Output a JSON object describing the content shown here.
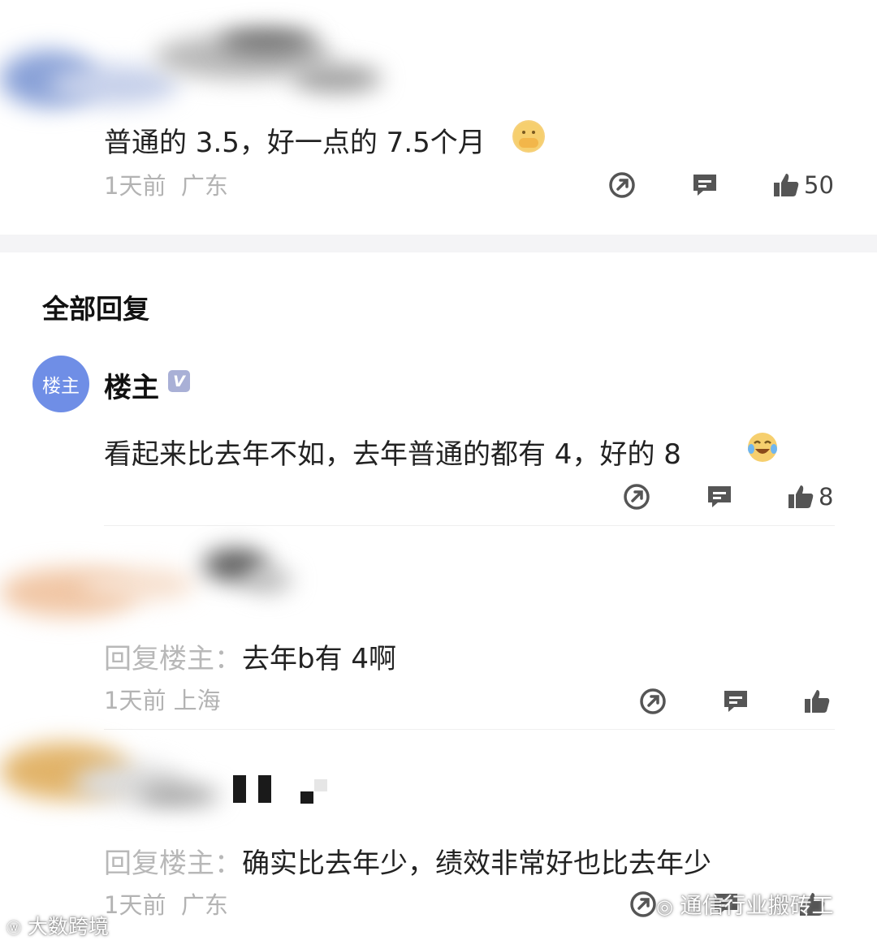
{
  "comments": [
    {
      "text": "普通的 3.5，好一点的 7.5个月",
      "time": "1天前",
      "location": "广东",
      "likes": "50",
      "emoji": "hands-over-mouth-emoji"
    }
  ],
  "replies_section": {
    "title": "全部回复"
  },
  "op_reply": {
    "avatar_label": "楼主",
    "name": "楼主",
    "badge": "V",
    "text": "看起来比去年不如，去年普通的都有 4，好的 8",
    "emoji": "tears-of-joy-emoji",
    "likes": "8"
  },
  "replies": [
    {
      "prefix": "回复楼主：",
      "text": "去年b有 4啊",
      "time": "1天前",
      "location": "上海"
    },
    {
      "prefix": "回复楼主：",
      "text": "确实比去年少，绩效非常好也比去年少",
      "time": "1天前",
      "location": "广东"
    }
  ],
  "icons": {
    "share": "share-icon",
    "comment": "comment-icon",
    "like": "thumbs-up-icon"
  },
  "watermarks": {
    "left": "大数跨境",
    "right": "通信行业搬砖工"
  },
  "colors": {
    "avatar_bg": "#6f8ee6",
    "badge_bg": "#a9b0d6",
    "icon": "#555555",
    "meta_text": "#b3b3b3",
    "section_band": "#f4f4f6"
  }
}
